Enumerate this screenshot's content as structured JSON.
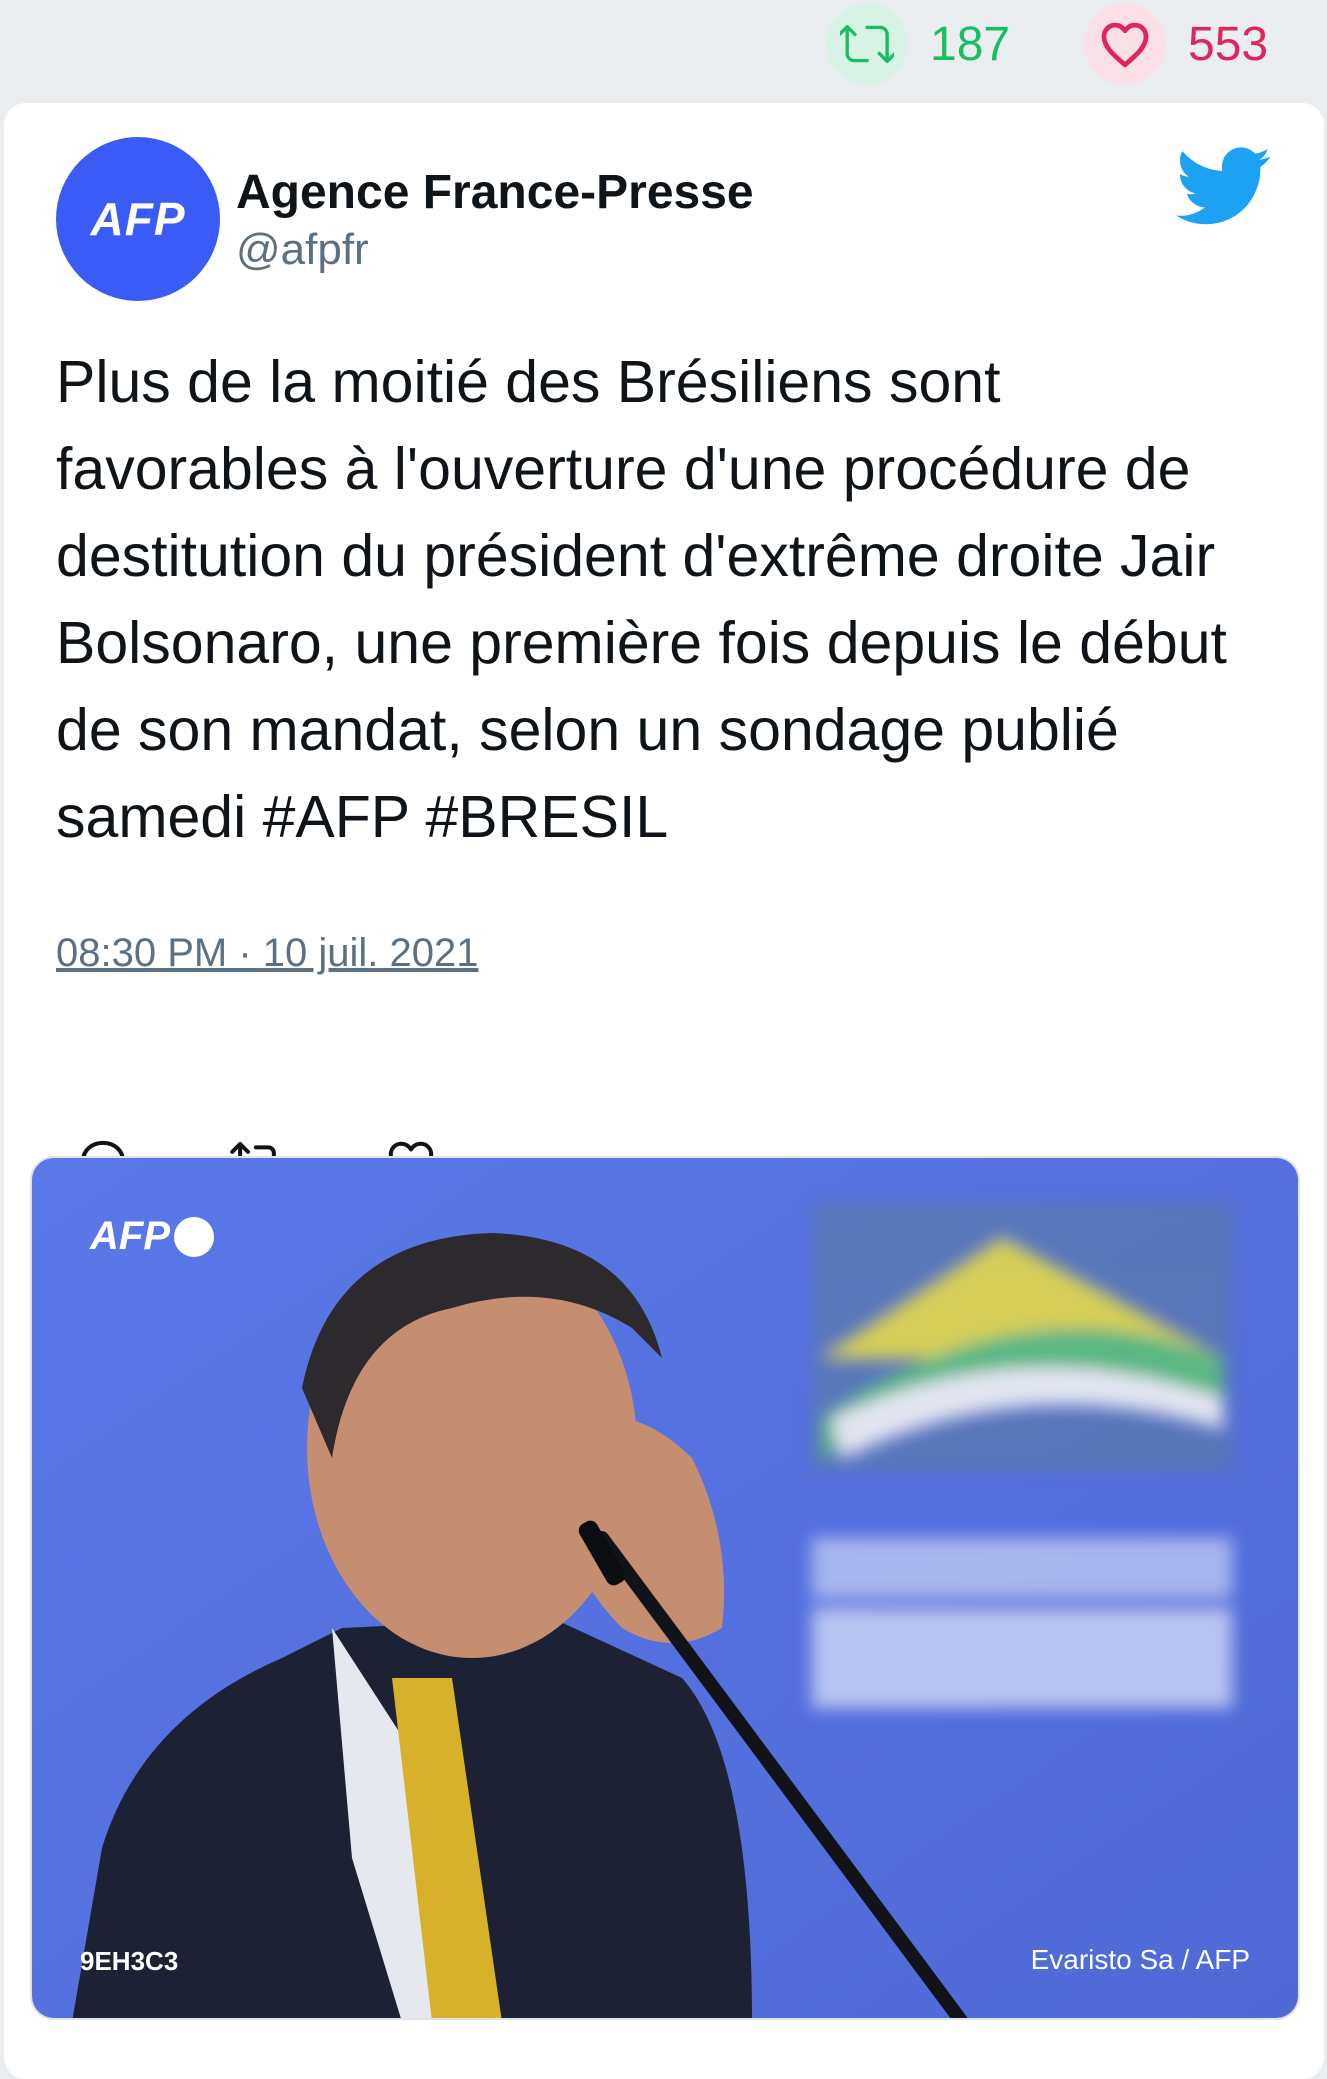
{
  "stats": {
    "retweet_count": "187",
    "like_count": "553",
    "retweet_icon": "retweet-icon",
    "like_icon": "heart-icon",
    "retweet_color": "#17bf63",
    "like_color": "#e0245e"
  },
  "author": {
    "avatar_text": "AFP",
    "name": "Agence France-Presse",
    "handle": "@afpfr",
    "avatar_color": "#3b5bf6"
  },
  "tweet": {
    "text": "Plus de la moitié des Brésiliens sont favorables à l'ouverture d'une procédure de destitution du président d'extrême droite Jair Bolsonaro, une première fois depuis le début de son mandat, selon un sondage publié samedi #AFP #BRESIL",
    "timestamp": "08:30 PM · 10 juil. 2021"
  },
  "actions": {
    "reply_icon": "reply-icon",
    "retweet_icon": "retweet-icon",
    "like_icon": "heart-icon"
  },
  "photo": {
    "logo_text": "AFP",
    "code": "9EH3C3",
    "credit": "Evaristo Sa / AFP",
    "background_color": "#5b78e0"
  },
  "brand": {
    "twitter_icon": "twitter-bird-icon",
    "twitter_color": "#1da1f2"
  }
}
